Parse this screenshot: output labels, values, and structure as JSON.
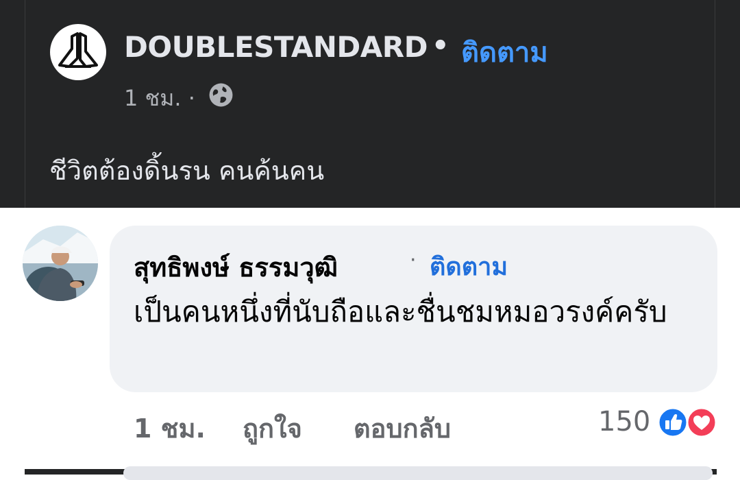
{
  "post": {
    "page_name": "DOUBLESTANDARD",
    "separator": "•",
    "follow_label": "ติดตาม",
    "time": "1 ชม. ·",
    "privacy_icon": "globe-icon",
    "text": "ชีวิตต้องดิ้นรน คนค้นคน"
  },
  "comment": {
    "author": "สุทธิพงษ์ ธรรมวุฒิ",
    "separator": "·",
    "follow_label": "ติดตาม",
    "text": "เป็นคนหนึ่งที่นับถือและชื่นชมหมอวรงค์ครับ",
    "time": "1 ชม.",
    "like_label": "ถูกใจ",
    "reply_label": "ตอบกลับ",
    "reaction_count": "150",
    "reactions": [
      "like-icon",
      "love-icon"
    ]
  },
  "colors": {
    "dark_bg": "#242526",
    "link_blue_dark": "#4599ff",
    "link_blue_light": "#216fdb",
    "bubble_bg": "#f0f2f5",
    "like_blue": "#1877f2",
    "love_red": "#f33e58"
  }
}
